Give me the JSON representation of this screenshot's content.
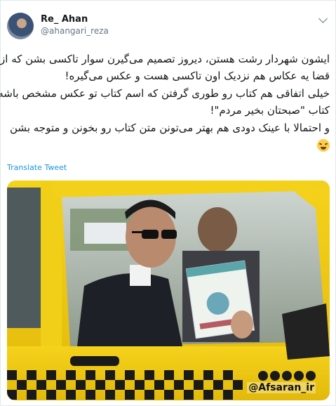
{
  "tweet": {
    "author": {
      "display_name": "Re_ Ahan",
      "handle": "@ahangari_reza"
    },
    "text_lines": [
      "ایشون شهردار رشت هستن، دیروز تصمیم می‌گیرن سوار تاکسی بشن که از",
      "قضا یه عکاس هم نزدیک اون تاکسی هست و عکس می‌گیره!",
      "خیلی اتفاقی هم کتاب رو طوری گرفتن که اسم کتاب تو عکس مشخص باشه؛",
      "کتاب \"صبحتان بخیر مردم\"!",
      "و احتمالا با عینک دودی هم بهتر می‌تونن متن کتاب رو بخونن و متوجه بشن"
    ],
    "emoji": "face-with-tears-of-joy",
    "translate_label": "Translate Tweet",
    "image": {
      "watermark_text": "@Afsaran_ir",
      "book_title": "صبحتان بخیر مردم"
    }
  }
}
